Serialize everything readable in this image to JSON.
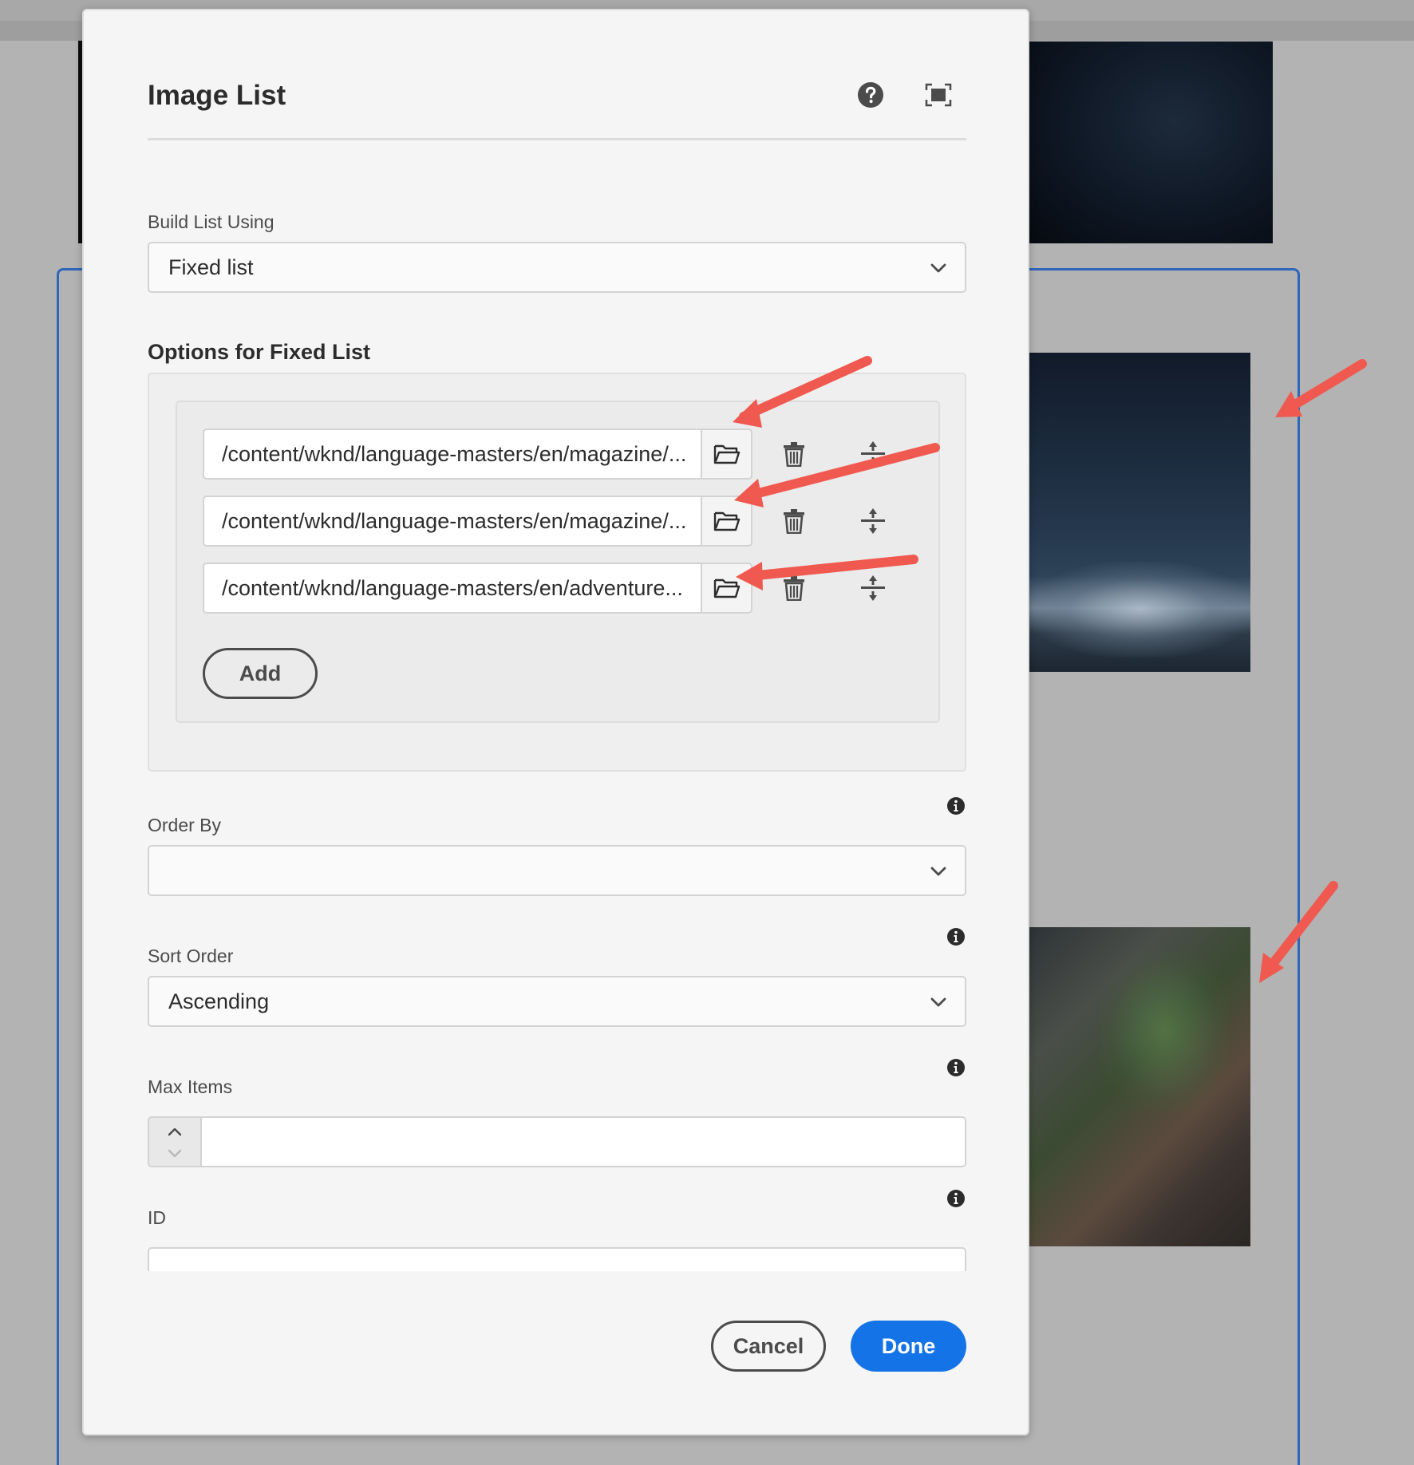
{
  "dialog": {
    "title": "Image List",
    "help_icon": "help-circle-icon",
    "fullscreen_icon": "fullscreen-icon"
  },
  "build_list": {
    "label": "Build List Using",
    "value": "Fixed list"
  },
  "fixed_list": {
    "heading": "Options for Fixed List",
    "items": [
      {
        "path": "/content/wknd/language-masters/en/magazine/..."
      },
      {
        "path": "/content/wknd/language-masters/en/magazine/..."
      },
      {
        "path": "/content/wknd/language-masters/en/adventure..."
      }
    ],
    "add_label": "Add"
  },
  "order_by": {
    "label": "Order By",
    "value": ""
  },
  "sort_order": {
    "label": "Sort Order",
    "value": "Ascending"
  },
  "max_items": {
    "label": "Max Items",
    "value": ""
  },
  "id_field": {
    "label": "ID",
    "value": ""
  },
  "footer": {
    "cancel_label": "Cancel",
    "done_label": "Done"
  },
  "colors": {
    "primary": "#1473e6",
    "annotation_arrow": "#f0594f",
    "frame_border": "#2f67b8"
  }
}
